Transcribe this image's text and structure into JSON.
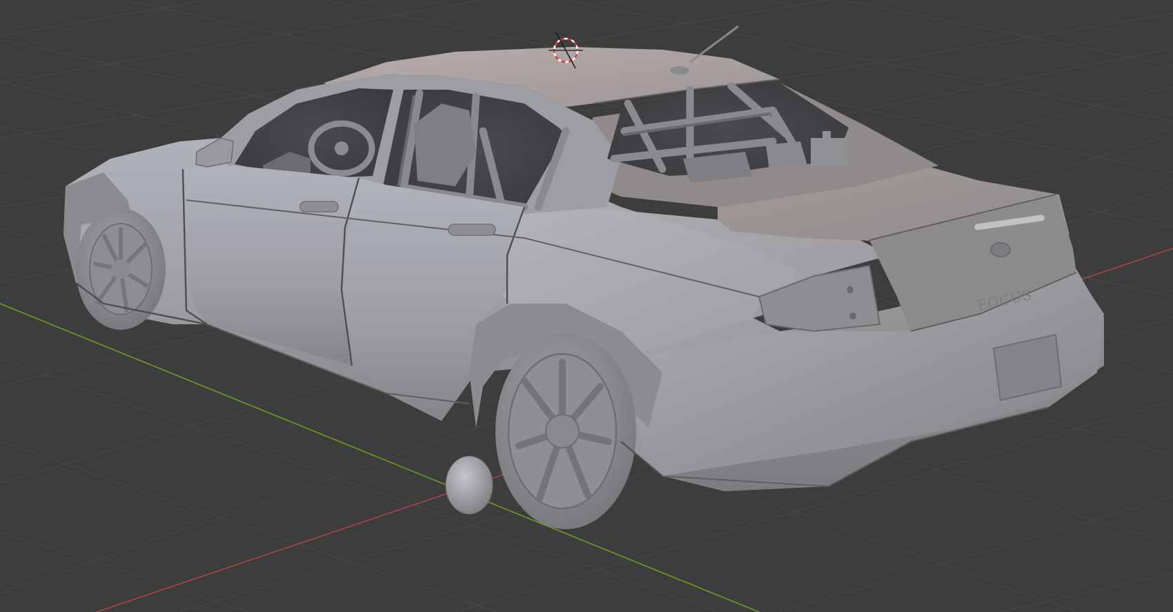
{
  "viewport": {
    "background_color": "#3d3d3d",
    "grid_color": "#474747",
    "x_axis_color": "#b0404a",
    "y_axis_color": "#6c9e22",
    "model_color": "#9a9a9e",
    "cursor_colors": [
      "#d63a3a",
      "#ffffff"
    ]
  },
  "scene": {
    "object": "car-model",
    "badge_text": "FOCUS",
    "icons": [
      "3d-cursor-icon",
      "light-sphere-gizmo"
    ]
  }
}
